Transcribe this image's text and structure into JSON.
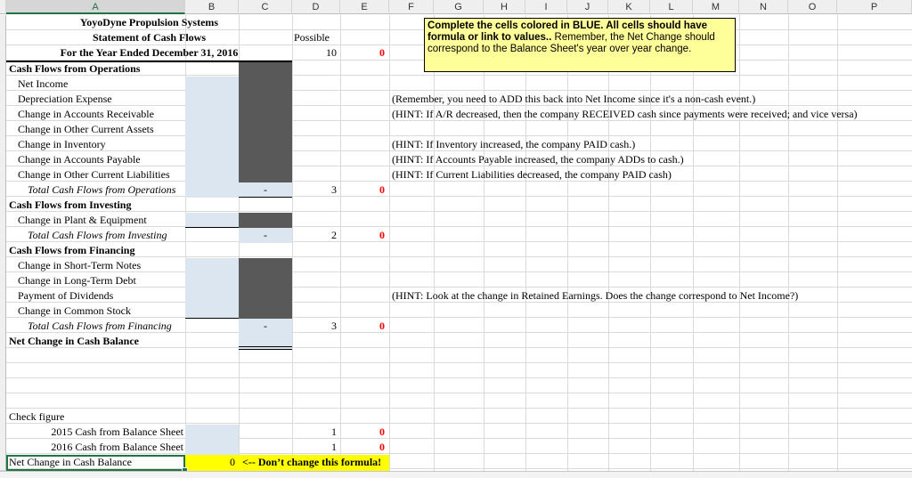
{
  "columns": [
    "A",
    "B",
    "C",
    "D",
    "E",
    "F",
    "G",
    "H",
    "I",
    "J",
    "K",
    "L",
    "M",
    "N",
    "O",
    "P"
  ],
  "header": {
    "company": "YoyoDyne Propulsion Systems",
    "statement": "Statement of Cash Flows",
    "period": "For the Year Ended December 31, 2016",
    "possible_label": "Possible",
    "possible_total": "10",
    "score_total": "0"
  },
  "instructions": {
    "bold_text": "Complete the cells colored in BLUE.  All cells should have formula or link to values..",
    "normal_text": "  Remember, the Net Change should correspond to the Balance Sheet's year over year change."
  },
  "rows": {
    "ops_heading": "Cash Flows from Operations",
    "net_income": "Net Income",
    "depreciation": "Depreciation Expense",
    "ar": "Change in Accounts Receivable",
    "oca": "Change in Other Current Assets",
    "inventory": "Change in Inventory",
    "ap": "Change in Accounts Payable",
    "ocl": "Change in Other Current Liabilities",
    "ops_total": "Total Cash Flows from Operations",
    "ops_total_value": "-",
    "ops_possible": "3",
    "ops_score": "0",
    "inv_heading": "Cash Flows from Investing",
    "pe": "Change in Plant & Equipment",
    "inv_total": "Total Cash Flows from Investing",
    "inv_total_value": "-",
    "inv_possible": "2",
    "inv_score": "0",
    "fin_heading": "Cash Flows from Financing",
    "stn": "Change in Short-Term Notes",
    "ltd": "Change in Long-Term Debt",
    "dividends": "Payment of Dividends",
    "common": "Change in Common Stock",
    "fin_total": "Total Cash Flows from Financing",
    "fin_total_value": "-",
    "fin_possible": "3",
    "fin_score": "0",
    "net_change": "Net Change in Cash Balance",
    "check_figure": "Check figure",
    "cash_2015": "2015 Cash from Balance Sheet",
    "cash_2015_possible": "1",
    "cash_2015_score": "0",
    "cash_2016": "2016 Cash from Balance Sheet",
    "cash_2016_possible": "1",
    "cash_2016_score": "0",
    "net_change_check": "Net Change in Cash Balance",
    "net_change_check_value": "0",
    "dont_change": "<-- Don’t change this formula!"
  },
  "hints": {
    "depreciation": "(Remember, you need to ADD this back into Net Income since it's a non-cash event.)",
    "ar": "(HINT:  If A/R decreased, then the company RECEIVED cash since payments were received; and vice versa)",
    "inventory": "(HINT:  If Inventory increased, the company PAID cash.)",
    "ap": "(HINT:  If  Accounts Payable increased, the company ADDs to cash.)",
    "ocl": "(HINT:  If Current Liabilities decreased, the company PAID cash)",
    "dividends": "(HINT:  Look at the change in Retained Earnings.  Does the change correspond to Net Income?)"
  },
  "colors": {
    "input_blue": "#dce6f1",
    "blocked_dark": "#595959",
    "note_yellow": "#ffff99",
    "highlight_yellow": "#ffff00",
    "score_red": "#ff0000",
    "selection_green": "#217346"
  }
}
